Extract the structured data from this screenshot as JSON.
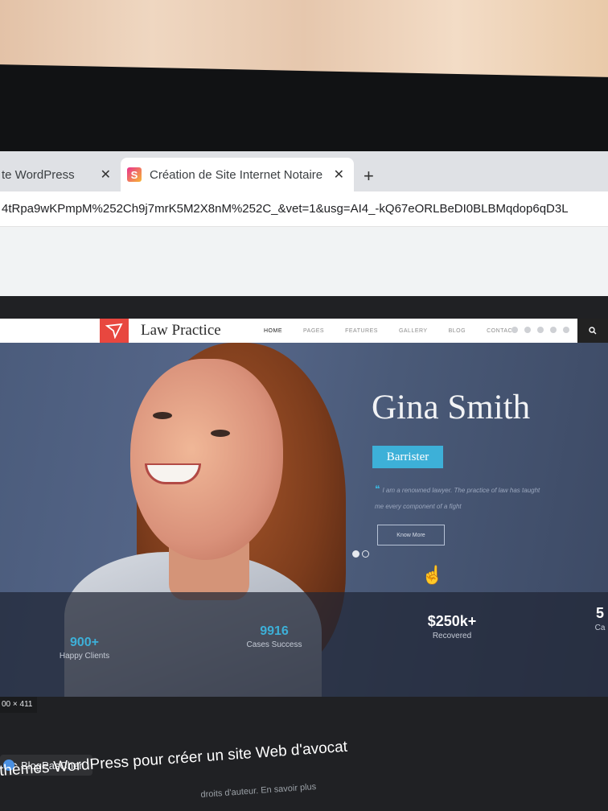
{
  "browser": {
    "tabs": [
      {
        "label": "te WordPress"
      },
      {
        "label": "Création de Site Internet Notaire"
      }
    ],
    "close_glyph": "✕",
    "new_tab_glyph": "+",
    "address": "4tRpa9wKPmpM%252Ch9j7mrK5M2X8nM%252C_&vet=1&usg=AI4_-kQ67eORLBeDI0BLBMqdop6qD3L"
  },
  "site": {
    "logo_text": "Law Practice",
    "menu": [
      "HOME",
      "PAGES",
      "FEATURES",
      "GALLERY",
      "BLOG",
      "CONTACT"
    ],
    "active_menu": "HOME",
    "hero": {
      "name": "Gina Smith",
      "badge": "Barrister",
      "quote": "I am a renowned lawyer. The practice of law has taught me every component of a fight",
      "button": "Know More"
    },
    "stats": [
      {
        "value": "900+",
        "label": "Happy Clients"
      },
      {
        "value": "9916",
        "label": "Cases Success"
      },
      {
        "value": "$250k+",
        "label": "Recovered"
      },
      {
        "value": "5",
        "label": "Ca"
      }
    ],
    "slider": {
      "count": 2,
      "active": 1
    }
  },
  "viewer": {
    "dimensions": "00 × 411",
    "source": "BlogPasCher",
    "title": "thèmes WordPress pour créer un site Web d'avocat",
    "rights": "droits d'auteur. En savoir plus"
  },
  "colors": {
    "accent": "#3db0d8",
    "logo": "#e8473f"
  }
}
